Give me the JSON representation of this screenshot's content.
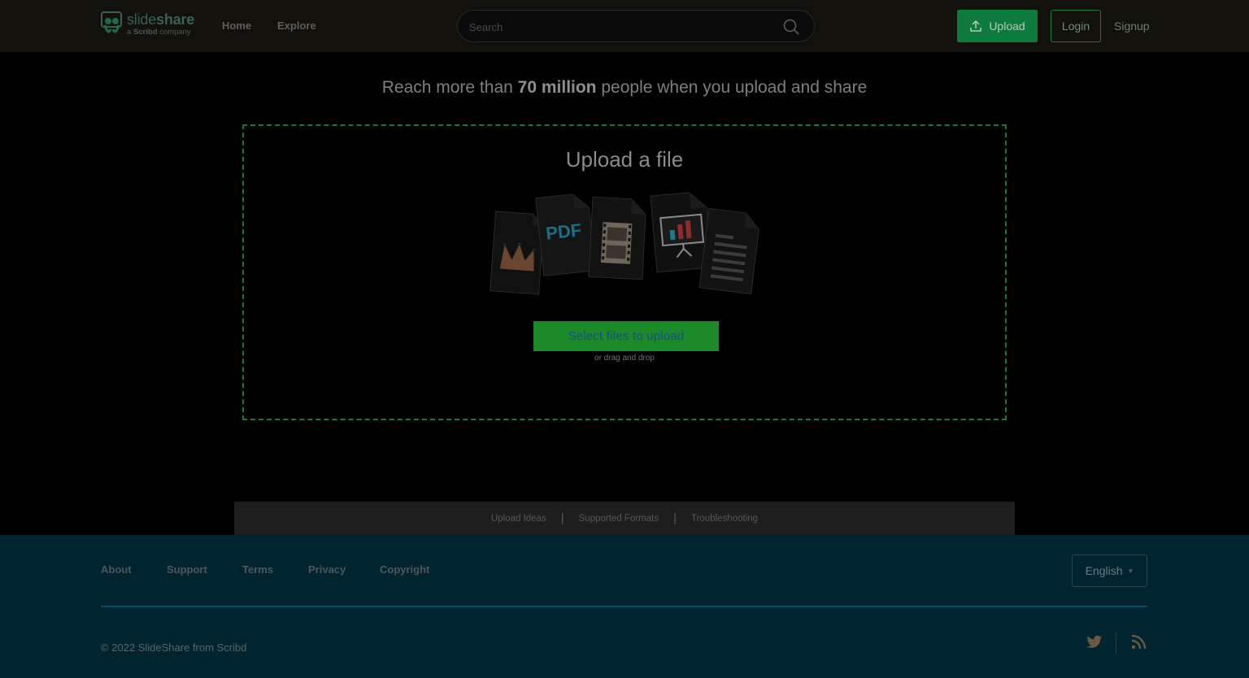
{
  "header": {
    "logo": {
      "word_light": "slide",
      "word_bold": "share",
      "sub_prefix": "a ",
      "sub_bold": "Scribd",
      "sub_suffix": " company"
    },
    "nav": [
      {
        "label": "Home"
      },
      {
        "label": "Explore"
      }
    ],
    "search": {
      "placeholder": "Search",
      "value": ""
    },
    "upload_label": "Upload",
    "login_label": "Login",
    "signup_label": "Signup"
  },
  "headline": {
    "before": "Reach more than ",
    "highlight": "70 million",
    "after": " people when you upload and share"
  },
  "upload": {
    "title": "Upload a file",
    "pdf_label": "PDF",
    "select_label": "Select files to upload",
    "hint": "or drag and drop"
  },
  "help": [
    {
      "label": "Upload Ideas"
    },
    {
      "label": "Supported Formats"
    },
    {
      "label": "Troubleshooting"
    }
  ],
  "help_separator": "|",
  "footer": {
    "links": [
      {
        "label": "About"
      },
      {
        "label": "Support"
      },
      {
        "label": "Terms"
      },
      {
        "label": "Privacy"
      },
      {
        "label": "Copyright"
      }
    ],
    "language": "English",
    "copyright": "© 2022 SlideShare from Scribd"
  },
  "colors": {
    "accent_green": "#0f7a3e",
    "dropzone_border": "#157a34",
    "footer_bg": "#012431",
    "header_bg": "#13110c"
  },
  "icons": [
    "search-icon",
    "upload-arrow-icon",
    "chevron-down-icon",
    "twitter-icon",
    "rss-icon",
    "slideshare-logo-icon"
  ]
}
